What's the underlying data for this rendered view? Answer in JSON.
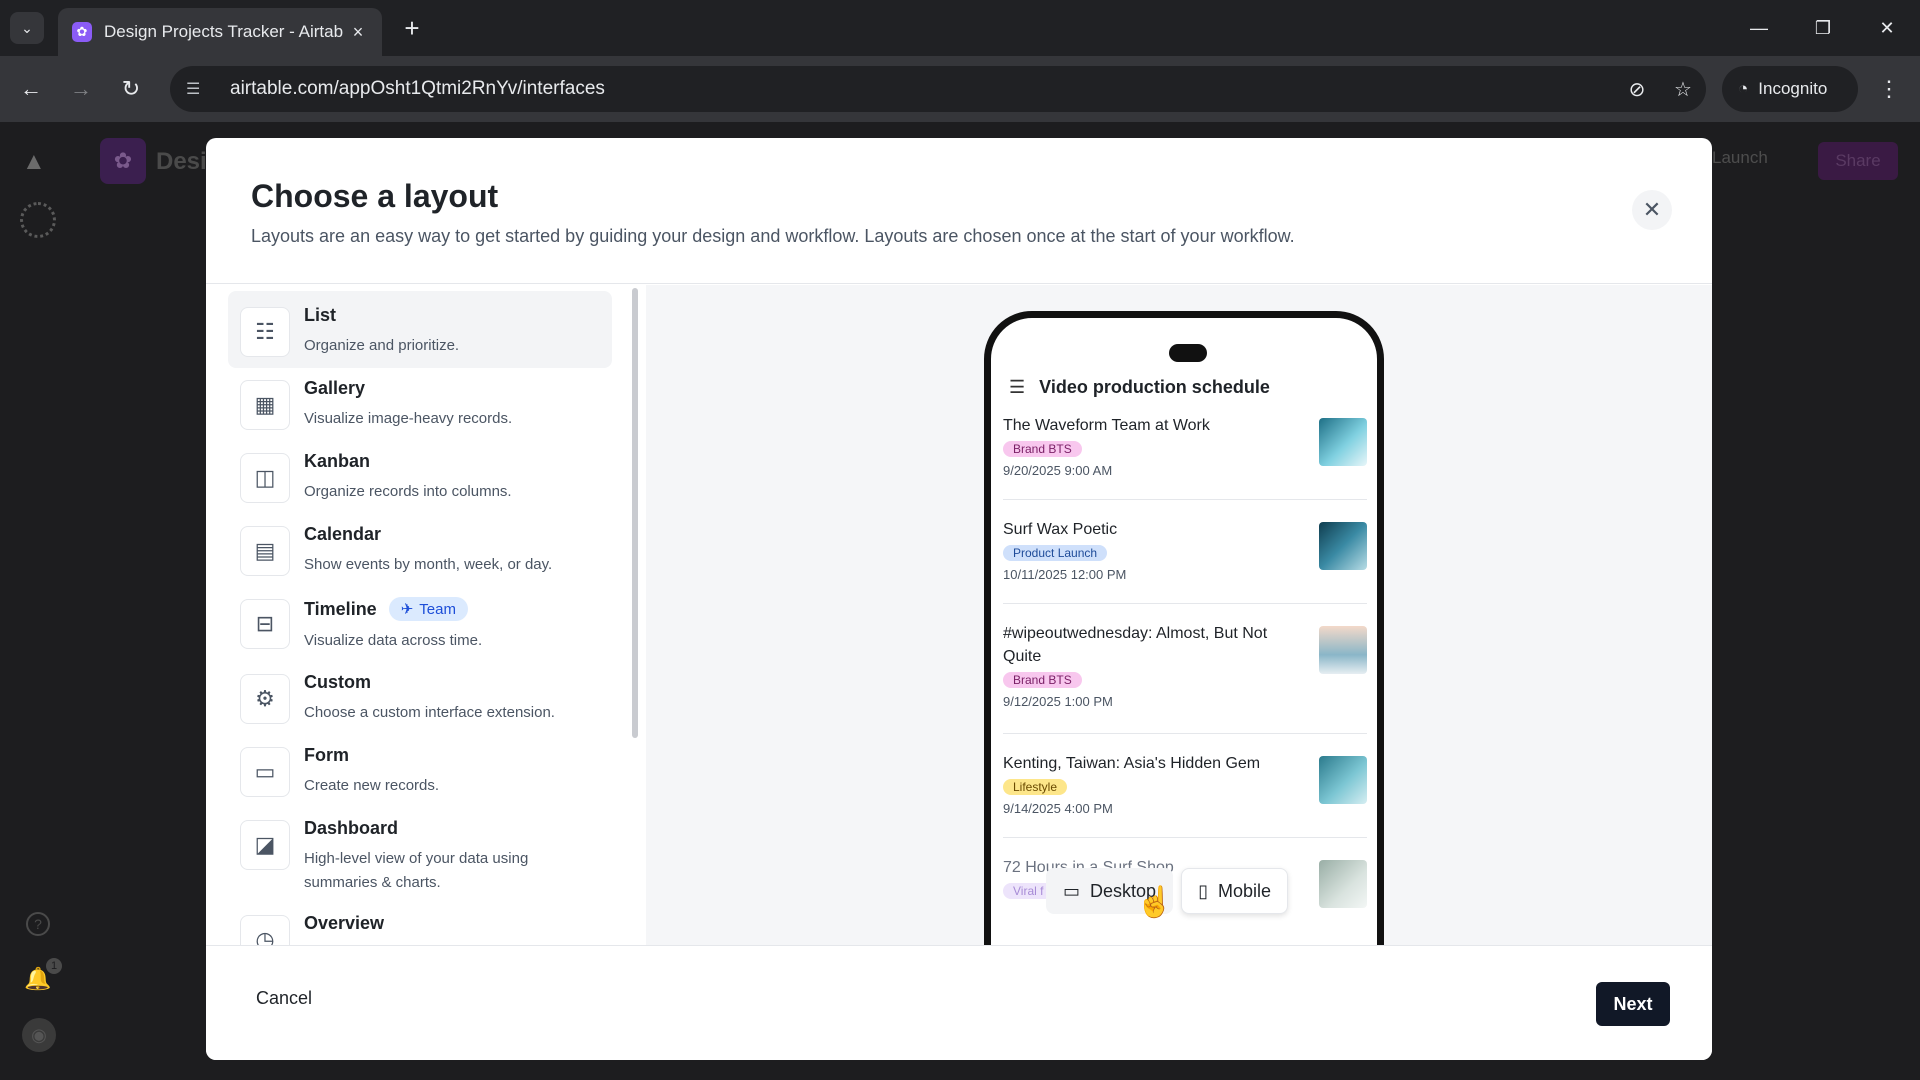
{
  "browser": {
    "tab_title": "Design Projects Tracker - Airtab",
    "url": "airtable.com/appOsht1Qtmi2RnYv/interfaces",
    "incognito_label": "Incognito"
  },
  "app": {
    "base_name": "Desi",
    "launch_label": "Launch",
    "share_label": "Share",
    "notification_count": "1"
  },
  "modal": {
    "title": "Choose a layout",
    "subtitle": "Layouts are an easy way to get started by guiding your design and workflow. Layouts are chosen once at the start of your workflow.",
    "layouts": [
      {
        "title": "List",
        "description": "Organize and prioritize.",
        "icon": "list-icon",
        "selected": true
      },
      {
        "title": "Gallery",
        "description": "Visualize image-heavy records.",
        "icon": "gallery-icon"
      },
      {
        "title": "Kanban",
        "description": "Organize records into columns.",
        "icon": "kanban-icon"
      },
      {
        "title": "Calendar",
        "description": "Show events by month, week, or day.",
        "icon": "calendar-icon"
      },
      {
        "title": "Timeline",
        "description": "Visualize data across time.",
        "icon": "timeline-icon",
        "badge": "Team"
      },
      {
        "title": "Custom",
        "description": "Choose a custom interface extension.",
        "icon": "gear-icon"
      },
      {
        "title": "Form",
        "description": "Create new records.",
        "icon": "form-icon"
      },
      {
        "title": "Dashboard",
        "description": "High-level view of your data using summaries & charts.",
        "icon": "chart-icon"
      },
      {
        "title": "Overview",
        "description": "",
        "icon": "overview-icon"
      }
    ],
    "preview": {
      "phone_title": "Video production schedule",
      "records": [
        {
          "title": "The Waveform Team at Work",
          "tag": "Brand BTS",
          "tag_color": "#f8c7ee",
          "date": "9/20/2025 9:00 AM"
        },
        {
          "title": "Surf Wax Poetic",
          "tag": "Product Launch",
          "tag_color": "#cfe0fb",
          "date": "10/11/2025 12:00 PM"
        },
        {
          "title": "#wipeoutwednesday: Almost, But Not Quite",
          "tag": "Brand BTS",
          "tag_color": "#f8c7ee",
          "date": "9/12/2025 1:00 PM"
        },
        {
          "title": "Kenting, Taiwan: Asia's Hidden Gem",
          "tag": "Lifestyle",
          "tag_color": "#fde68a",
          "date": "9/14/2025 4:00 PM"
        },
        {
          "title": "72 Hours in a Surf Shop",
          "tag": "Viral f",
          "tag_color": "#e9d5ff",
          "date": ""
        }
      ],
      "desktop_label": "Desktop",
      "mobile_label": "Mobile"
    },
    "cancel_label": "Cancel",
    "next_label": "Next"
  }
}
